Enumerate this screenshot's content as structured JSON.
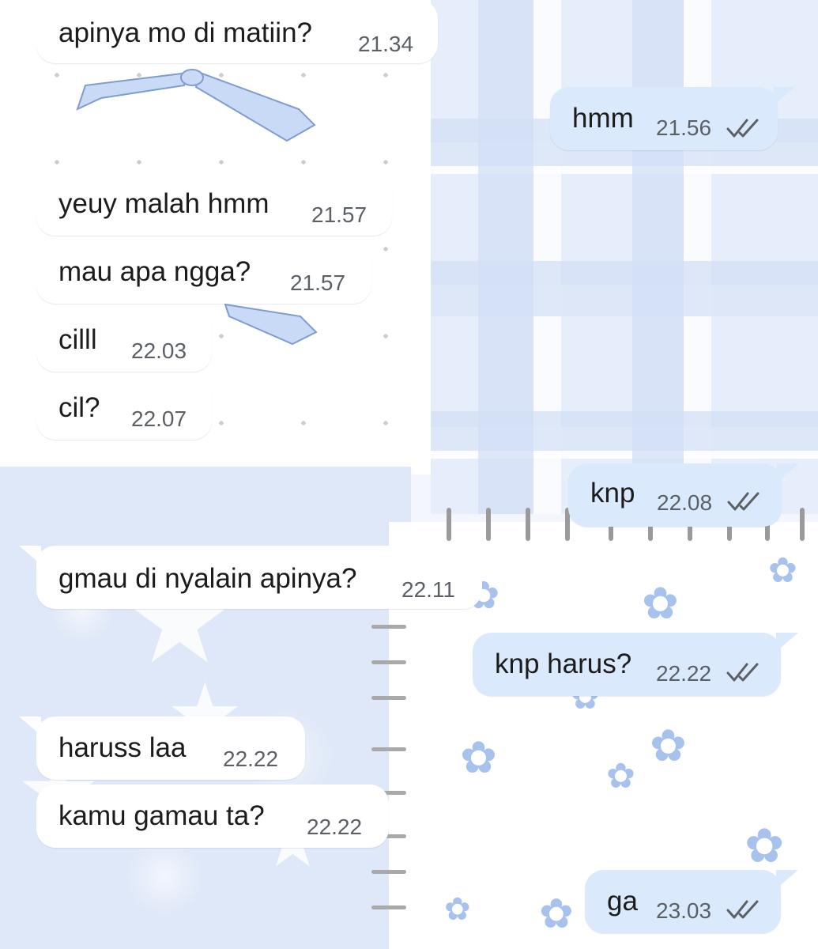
{
  "chat": {
    "messages": [
      {
        "direction": "in",
        "text": "apinya mo di matiin?",
        "time": "21.34"
      },
      {
        "direction": "out",
        "text": "hmm",
        "time": "21.56",
        "read": true
      },
      {
        "direction": "in",
        "text": "yeuy malah hmm",
        "time": "21.57"
      },
      {
        "direction": "in",
        "text": "mau apa ngga?",
        "time": "21.57"
      },
      {
        "direction": "in",
        "text": "cilll",
        "time": "22.03"
      },
      {
        "direction": "in",
        "text": "cil?",
        "time": "22.07"
      },
      {
        "direction": "out",
        "text": "knp",
        "time": "22.08",
        "read": true
      },
      {
        "direction": "in",
        "text": "gmau di nyalain apinya?",
        "time": "22.11"
      },
      {
        "direction": "out",
        "text": "knp harus?",
        "time": "22.22",
        "read": true
      },
      {
        "direction": "in",
        "text": "haruss laa",
        "time": "22.22"
      },
      {
        "direction": "in",
        "text": "kamu gamau ta?",
        "time": "22.22"
      },
      {
        "direction": "out",
        "text": "ga",
        "time": "23.03",
        "read": true
      }
    ]
  },
  "colors": {
    "incoming_bubble": "#ffffff",
    "outgoing_bubble": "#dbe9fc",
    "text": "#1c1c1c",
    "timestamp": "#5b5f66",
    "read_ticks": "#5b5f66"
  },
  "icons": {
    "read_receipt": "double-check-icon"
  }
}
